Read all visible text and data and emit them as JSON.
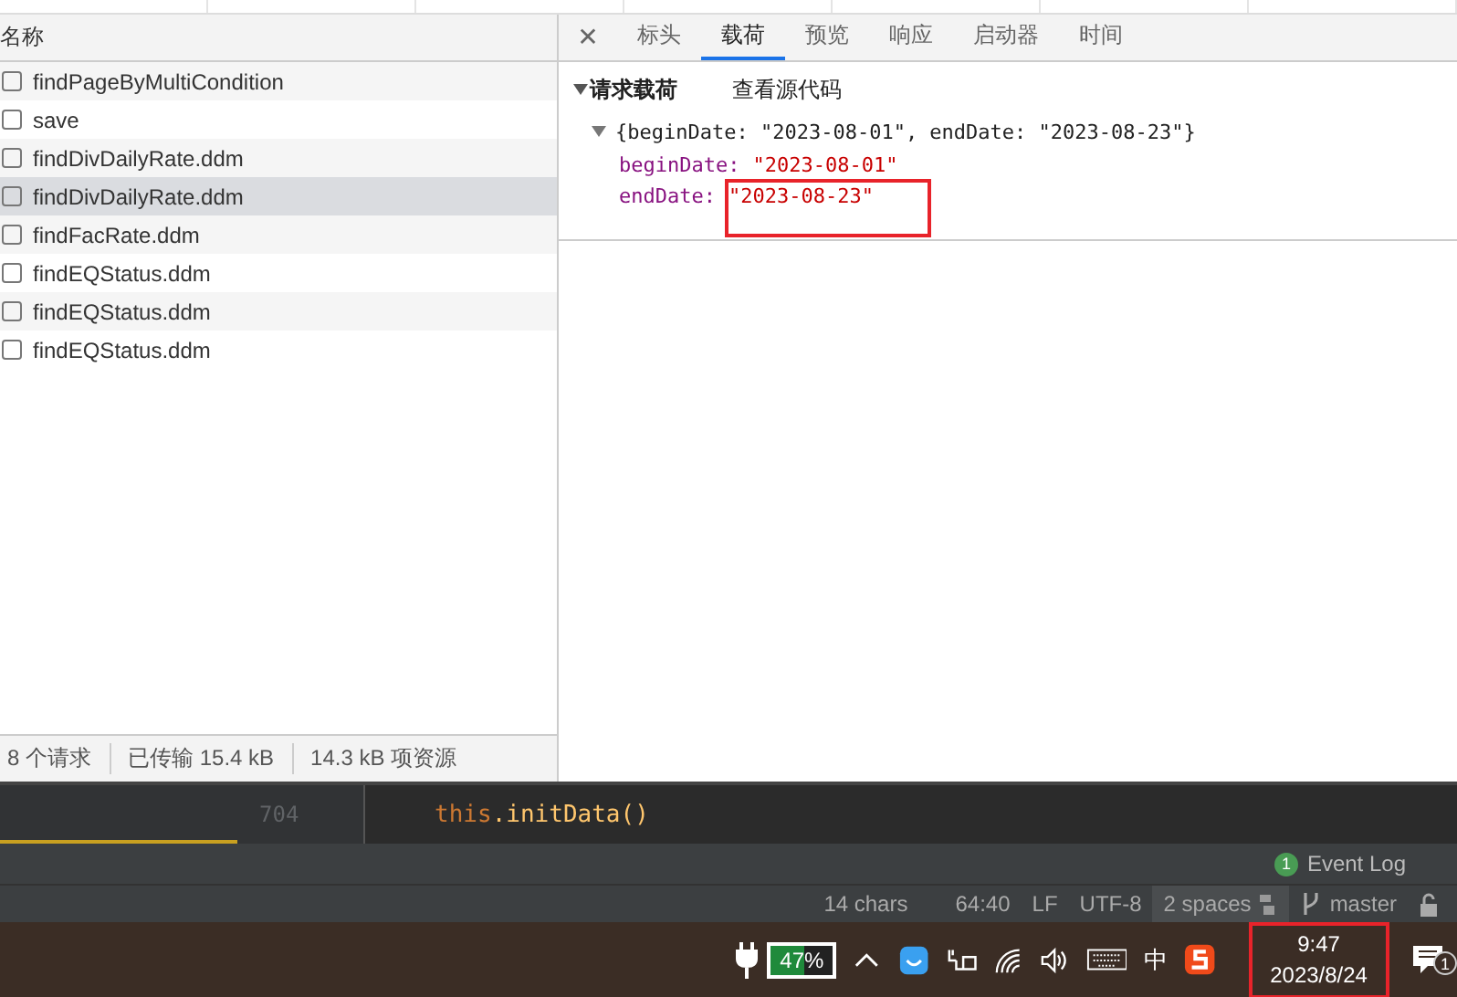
{
  "requests": {
    "column": "名称",
    "rows": [
      {
        "name": "findPageByMultiCondition",
        "selected": false
      },
      {
        "name": "save",
        "selected": false
      },
      {
        "name": "findDivDailyRate.ddm",
        "selected": false
      },
      {
        "name": "findDivDailyRate.ddm",
        "selected": true
      },
      {
        "name": "findFacRate.ddm",
        "selected": false
      },
      {
        "name": "findEQStatus.ddm",
        "selected": false
      },
      {
        "name": "findEQStatus.ddm",
        "selected": false
      },
      {
        "name": "findEQStatus.ddm",
        "selected": false
      }
    ],
    "summary": [
      "8 个请求",
      "已传输 15.4 kB",
      "14.3 kB 项资源"
    ]
  },
  "details": {
    "close": "✕",
    "tabs": [
      {
        "label": "标头",
        "selected": false
      },
      {
        "label": "载荷",
        "selected": true
      },
      {
        "label": "预览",
        "selected": false
      },
      {
        "label": "响应",
        "selected": false
      },
      {
        "label": "启动器",
        "selected": false
      },
      {
        "label": "时间",
        "selected": false
      }
    ],
    "section": {
      "title": "请求载荷",
      "expanded": true,
      "action": "查看源代码",
      "object": {
        "summary": "{beginDate: \"2023-08-01\", endDate: \"2023-08-23\"}",
        "expanded": true,
        "fields": [
          {
            "key": "beginDate:",
            "value": "\"2023-08-01\"",
            "highlighted": false
          },
          {
            "key": "endDate:",
            "value": "\"2023-08-23\"",
            "highlighted": true
          }
        ]
      }
    }
  },
  "editor": {
    "line_number": "704",
    "code": [
      {
        "text": "this",
        "kind": "keyword"
      },
      {
        "text": ".initData()",
        "kind": "call"
      }
    ]
  },
  "event_log": {
    "count": "1",
    "label": "Event Log"
  },
  "status_bar": [
    "14 chars",
    "64:40",
    "LF",
    "UTF-8",
    "2 spaces",
    "master"
  ],
  "taskbar": {
    "battery": "47%",
    "ime": "中",
    "time": "9:47",
    "date": "2023/8/24",
    "date_highlighted": true,
    "notifications": "1"
  }
}
